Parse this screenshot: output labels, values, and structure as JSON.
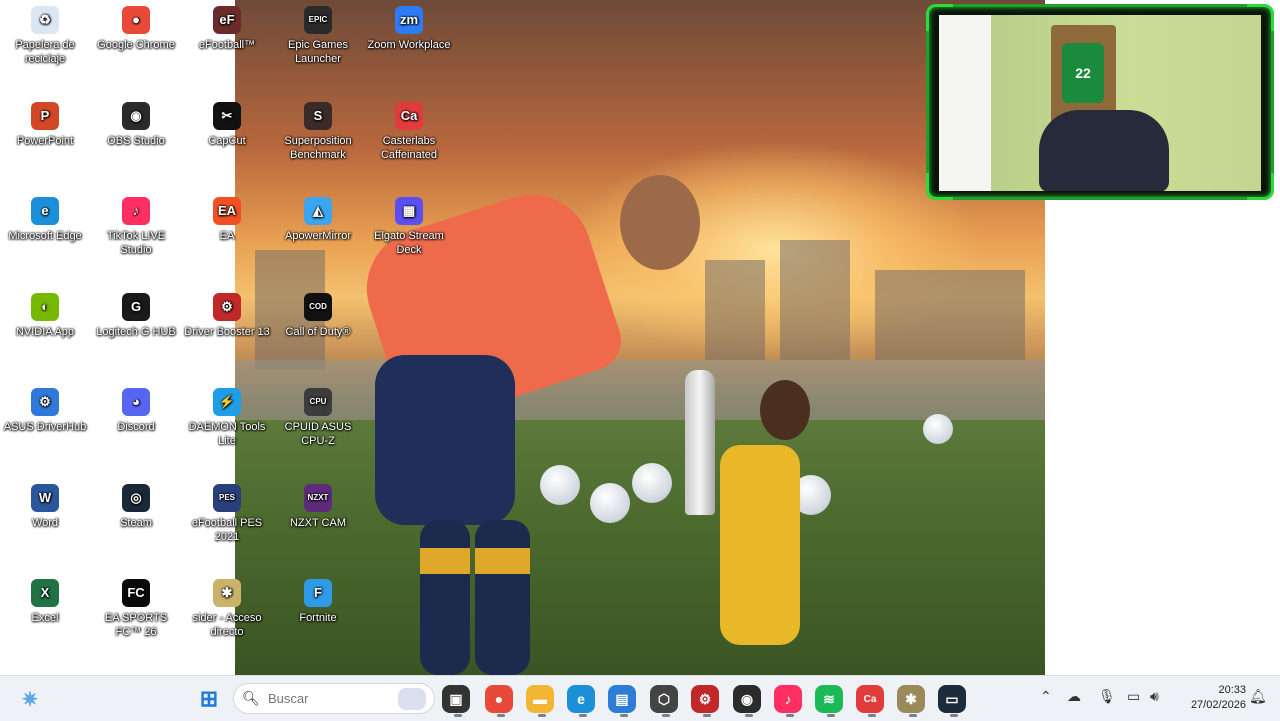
{
  "desktop": {
    "icons": [
      {
        "label": "Papelera de reciclaje",
        "glyph": "♻",
        "color": "#dbe6f3",
        "icon": "recycle-bin-icon"
      },
      {
        "label": "Google Chrome",
        "glyph": "●",
        "color": "#e84a3a",
        "icon": "chrome-icon"
      },
      {
        "label": "eFootball™",
        "glyph": "eF",
        "color": "#6b2b2b",
        "icon": "efootball-icon"
      },
      {
        "label": "Epic Games Launcher",
        "glyph": "EPIC",
        "color": "#2a2a2a",
        "icon": "epic-games-icon"
      },
      {
        "label": "Zoom Workplace",
        "glyph": "zm",
        "color": "#2d7cf6",
        "icon": "zoom-icon"
      },
      {
        "label": "PowerPoint",
        "glyph": "P",
        "color": "#d24726",
        "icon": "powerpoint-icon"
      },
      {
        "label": "OBS Studio",
        "glyph": "◉",
        "color": "#2b2b2b",
        "icon": "obs-icon"
      },
      {
        "label": "CapCut",
        "glyph": "✂",
        "color": "#111111",
        "icon": "capcut-icon"
      },
      {
        "label": "Superposition Benchmark",
        "glyph": "S",
        "color": "#3a2a2a",
        "icon": "superposition-icon"
      },
      {
        "label": "Casterlabs Caffeinated",
        "glyph": "Ca",
        "color": "#e23b3b",
        "icon": "casterlabs-icon"
      },
      {
        "label": "Microsoft Edge",
        "glyph": "e",
        "color": "#1b8fd8",
        "icon": "edge-icon"
      },
      {
        "label": "TikTok LIVE Studio",
        "glyph": "♪",
        "color": "#ff2e63",
        "icon": "tiktok-live-icon"
      },
      {
        "label": "EA",
        "glyph": "EA",
        "color": "#f25022",
        "icon": "ea-icon"
      },
      {
        "label": "ApowerMirror",
        "glyph": "◭",
        "color": "#3aa6f0",
        "icon": "apowermirror-icon"
      },
      {
        "label": "Elgato Stream Deck",
        "glyph": "▦",
        "color": "#5a4ff2",
        "icon": "stream-deck-icon"
      },
      {
        "label": "NVIDIA App",
        "glyph": "◐",
        "color": "#76b900",
        "icon": "nvidia-icon"
      },
      {
        "label": "Logitech G HUB",
        "glyph": "G",
        "color": "#1a1a1a",
        "icon": "logitech-icon"
      },
      {
        "label": "Driver Booster 13",
        "glyph": "⚙",
        "color": "#c0282a",
        "icon": "driver-booster-icon"
      },
      {
        "label": "Call of Duty®",
        "glyph": "COD",
        "color": "#111111",
        "icon": "call-of-duty-icon"
      },
      {
        "label": "ASUS DriverHub",
        "glyph": "⚙",
        "color": "#2f7ad9",
        "icon": "asus-driverhub-icon"
      },
      {
        "label": "Discord",
        "glyph": "◕",
        "color": "#5865f2",
        "icon": "discord-icon"
      },
      {
        "label": "DAEMON Tools Lite",
        "glyph": "⚡",
        "color": "#1e9ee6",
        "icon": "daemon-tools-icon"
      },
      {
        "label": "CPUID ASUS CPU-Z",
        "glyph": "CPU",
        "color": "#3c3c3c",
        "icon": "cpu-z-icon"
      },
      {
        "label": "Word",
        "glyph": "W",
        "color": "#2b579a",
        "icon": "word-icon"
      },
      {
        "label": "Steam",
        "glyph": "◎",
        "color": "#1b2838",
        "icon": "steam-icon"
      },
      {
        "label": "eFootball PES 2021",
        "glyph": "PES",
        "color": "#2a3f7a",
        "icon": "pes-2021-icon"
      },
      {
        "label": "NZXT CAM",
        "glyph": "NZXT",
        "color": "#5e2a7a",
        "icon": "nzxt-cam-icon"
      },
      {
        "label": "Excel",
        "glyph": "X",
        "color": "#217346",
        "icon": "excel-icon"
      },
      {
        "label": "EA SPORTS FC™ 26",
        "glyph": "FC",
        "color": "#0a0a0a",
        "icon": "ea-fc-26-icon"
      },
      {
        "label": "sider - Acceso directo",
        "glyph": "✱",
        "color": "#c9b26a",
        "icon": "sider-icon"
      },
      {
        "label": "Fortnite",
        "glyph": "F",
        "color": "#2f9be8",
        "icon": "fortnite-icon"
      }
    ]
  },
  "webcam": {
    "jersey_number": "22"
  },
  "taskbar": {
    "search_placeholder": "Buscar",
    "clock_time": "20:33",
    "clock_date": "27/02/2026",
    "apps": [
      {
        "name": "widgets",
        "glyph": "✷",
        "color": "#5aa9e6"
      },
      {
        "name": "start",
        "glyph": "⊞",
        "color": "#1e7ad6"
      },
      {
        "name": "task-view",
        "glyph": "▣",
        "color": "#333333"
      },
      {
        "name": "chrome",
        "glyph": "●",
        "color": "#e84a3a"
      },
      {
        "name": "file-explorer",
        "glyph": "▬",
        "color": "#f2b634"
      },
      {
        "name": "edge",
        "glyph": "e",
        "color": "#1b8fd8"
      },
      {
        "name": "store",
        "glyph": "▤",
        "color": "#2d7cd6"
      },
      {
        "name": "3d-app",
        "glyph": "⬡",
        "color": "#444444"
      },
      {
        "name": "driver-booster",
        "glyph": "⚙",
        "color": "#c0282a"
      },
      {
        "name": "obs",
        "glyph": "◉",
        "color": "#2b2b2b"
      },
      {
        "name": "tiktok",
        "glyph": "♪",
        "color": "#ff2e63"
      },
      {
        "name": "spotify",
        "glyph": "≋",
        "color": "#1db954"
      },
      {
        "name": "casterlabs",
        "glyph": "Ca",
        "color": "#e23b3b"
      },
      {
        "name": "tools",
        "glyph": "✱",
        "color": "#9a8a5a"
      },
      {
        "name": "monitor-app",
        "glyph": "▭",
        "color": "#1c2c3c"
      }
    ]
  }
}
